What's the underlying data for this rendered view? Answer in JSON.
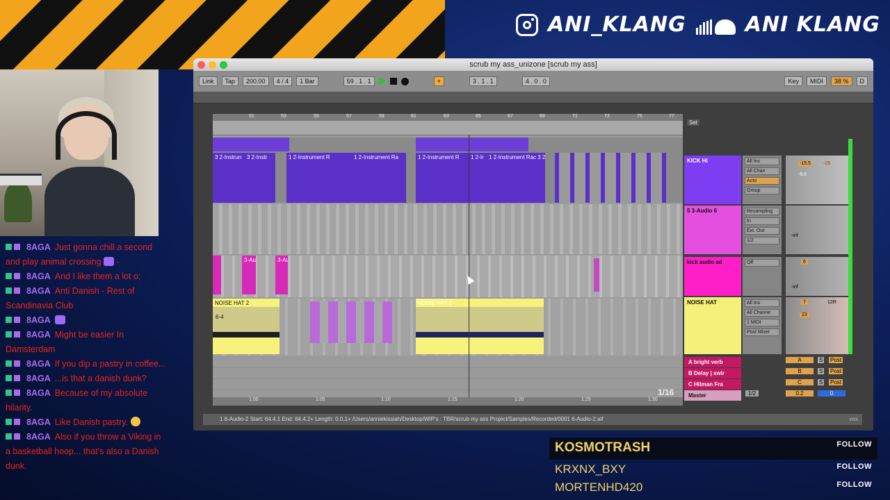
{
  "overlay": {
    "instagram_handle": "ANI_KLANG",
    "soundcloud_handle": "ANI KLANG",
    "icons": {
      "instagram": "instagram-icon",
      "soundcloud": "soundcloud-icon"
    }
  },
  "chat": [
    {
      "user": "8AGA",
      "text": "Just gonna chill a second and play animal crossing",
      "suffix": " -",
      "emote": true
    },
    {
      "user": "8AGA",
      "text": "And I like them a lot o;"
    },
    {
      "user": "8AGA",
      "text": "Anti Danish - Rest of Scandinavia Club"
    },
    {
      "user": "8AGA",
      "text": "",
      "emote": true
    },
    {
      "user": "8AGA",
      "text": "Might be easier In Damsterdam"
    },
    {
      "user": "8AGA",
      "text": "If you dip a pastry in coffee..."
    },
    {
      "user": "8AGA",
      "text": "...is that a danish dunk?"
    },
    {
      "user": "8AGA",
      "text": "Because of my absolute hilarity."
    },
    {
      "user": "8AGA",
      "text": "Like Danish pastry.",
      "emoji": true
    },
    {
      "user": "8AGA",
      "text": "Also if you throw a Viking in a basketball hoop... that's also a Danish dunk."
    }
  ],
  "followers": [
    {
      "name": "KOSMOTRASH",
      "action": "FOLLOW"
    },
    {
      "name": "KRXNX_BXY",
      "action": "FOLLOW"
    },
    {
      "name": "MORTENHD420",
      "action": "FOLLOW"
    }
  ],
  "ableton": {
    "window_title": "scrub my ass_unizone  [scrub my ass]",
    "control_bar": {
      "link": "Link",
      "tap": "Tap",
      "tempo": "200.00",
      "signature": "4 / 4",
      "quantize": "1 Bar",
      "position": "59 .  1 .  1",
      "loop_start": "3 .  1 .  1",
      "loop_length": "4 .  0 .  0",
      "key": "Key",
      "midi": "MIDI",
      "cpu": "38 %",
      "d": "D"
    },
    "ruler_bars": [
      "51",
      "53",
      "55",
      "57",
      "59",
      "61",
      "63",
      "65",
      "67",
      "69",
      "71",
      "73",
      "75",
      "77"
    ],
    "time_marks": [
      "1:00",
      "1:05",
      "1:10",
      "1:15",
      "1:20",
      "1:25",
      "1:30"
    ],
    "set_label": "Set",
    "page_indicator": "1/16",
    "clips": {
      "instrument": [
        "3 2-Instrun",
        "3 2-Instr",
        "1 2-Instrument R",
        "1 2-Instrument Ra",
        "1 2-Instrument R",
        "1 2-Ir",
        "1 2-Instrument Rac 3 2"
      ],
      "audio3": [
        "3-Au",
        "3-Au"
      ],
      "noise1": "NOISE HAT 2",
      "noise1_sub": "6-4",
      "noise2": "NOISE HAT 2"
    },
    "tracks": [
      {
        "name": "KICK HI",
        "color": "#7c3ef0"
      },
      {
        "name": "5 3-Audio 6",
        "color": "#e44fe0"
      },
      {
        "name": "kick audio ad",
        "color": "#ff1fc8"
      },
      {
        "name": "NOISE HAT",
        "color": "#f5f07a"
      }
    ],
    "returns": [
      {
        "name": "A bright verb",
        "send": "A"
      },
      {
        "name": "B Delay | swir",
        "send": "B"
      },
      {
        "name": "C Hitman Fra",
        "send": "C"
      },
      {
        "name": "Master",
        "send": ""
      }
    ],
    "io": {
      "all_ins": "All Ins",
      "all_channels": "All Chan",
      "in": "In",
      "auto": "Auto",
      "off": "Off",
      "group": "Group",
      "resampling": "Resampling",
      "ext_out": "Ext. Out",
      "half": "1/2",
      "all_channels_2": "All Channe",
      "midi_1": "1 MIDI",
      "post_mixer": "Post Mixer",
      "master_out": "1/2"
    },
    "mixer": {
      "minus_inf": "-inf",
      "vol1": "-15.5",
      "vol2": "-26",
      "vol3": "-6.6",
      "tr1": "6",
      "tr2": "7",
      "pan1": "12R",
      "num_23": "23",
      "ret_a": "A",
      "ret_b": "B",
      "ret_c": "C",
      "solo": "S",
      "post": "Post",
      "master_vol": "0.2",
      "master_pan": "0"
    },
    "status_text": "1 6-Audio-2  Start: 64.4.1  End: 64.4.2+  Length: 0.0.1+  /Users/anniekissiah/Desktop/WIP's : TBR/scrub my ass Project/Samples/Recorded/0001 6-Audio-2.aif",
    "status_right": "vox"
  }
}
